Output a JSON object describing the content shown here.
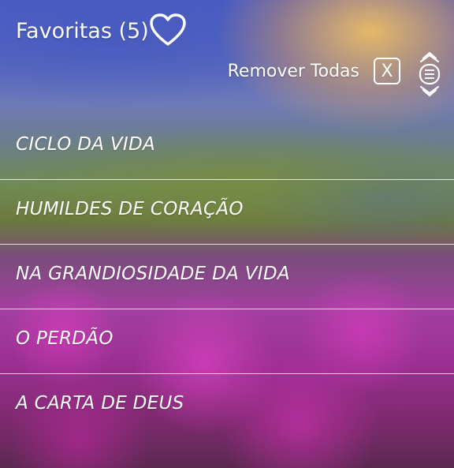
{
  "header": {
    "title": "Favoritas (5)",
    "icon": "heart-icon"
  },
  "toolbar": {
    "remove_all_label": "Remover Todas",
    "clear_button_label": "X",
    "reorder_icon": "reorder-icon"
  },
  "favorites": [
    {
      "label": "CICLO DA VIDA"
    },
    {
      "label": "HUMILDES DE CORAÇÃO"
    },
    {
      "label": "NA GRANDIOSIDADE DA VIDA"
    },
    {
      "label": "O PERDÃO"
    },
    {
      "label": "A CARTA DE DEUS"
    }
  ]
}
